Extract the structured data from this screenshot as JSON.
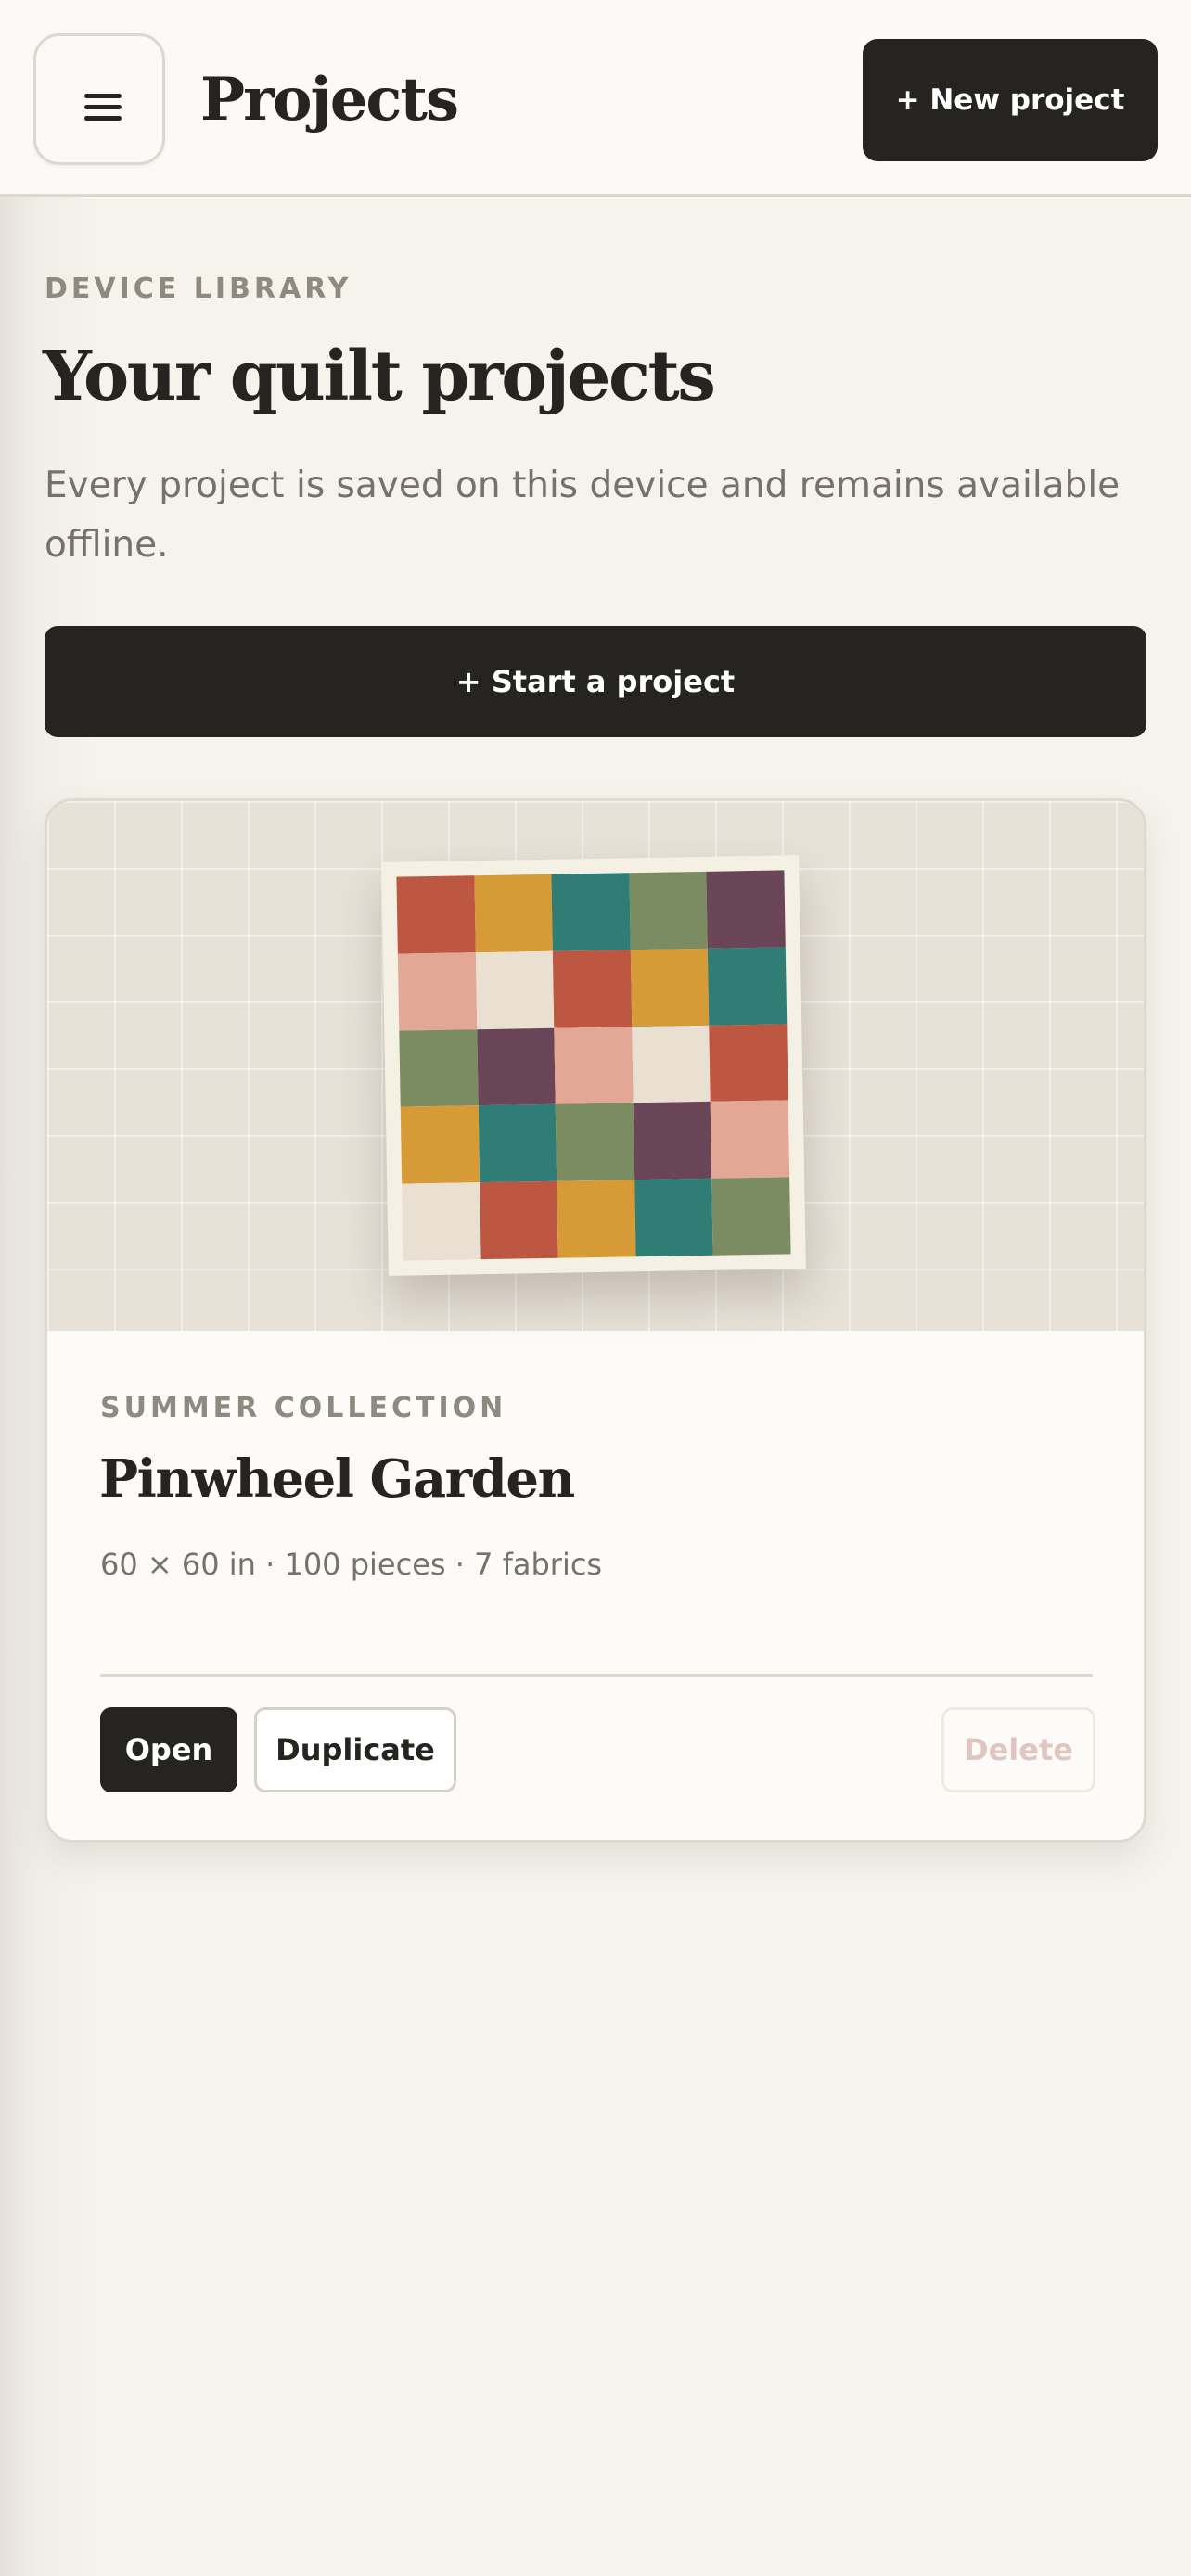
{
  "header": {
    "menu_icon": "menu-icon",
    "title": "Projects",
    "new_project_label": "+ New project"
  },
  "intro": {
    "eyebrow": "DEVICE LIBRARY",
    "heading": "Your quilt projects",
    "description": "Every project is saved on this device and remains available offline.",
    "start_label": "+ Start a project"
  },
  "projects": [
    {
      "collection": "SUMMER COLLECTION",
      "name": "Pinwheel Garden",
      "meta": "60 × 60 in · 100 pieces · 7 fabrics",
      "actions": {
        "open": "Open",
        "duplicate": "Duplicate",
        "delete": "Delete"
      },
      "quilt_patches": [
        "#bd5741",
        "#d69b36",
        "#2f7d74",
        "#7b8c63",
        "#6a4558",
        "#e2a795",
        "#e9e0d1",
        "#bd5741",
        "#d69b36",
        "#2f7d74",
        "#7b8c63",
        "#6a4558",
        "#e2a795",
        "#e9e0d1",
        "#bd5741",
        "#d69b36",
        "#2f7d74",
        "#7b8c63",
        "#6a4558",
        "#e2a795",
        "#e9e0d1",
        "#bd5741",
        "#d69b36",
        "#2f7d74",
        "#7b8c63"
      ]
    }
  ],
  "colors": {
    "primary": "#252420",
    "muted_text": "#76716a",
    "eyebrow_text": "#8f8a81",
    "background": "#f6f3ed",
    "delete_disabled": "#e0c6c0"
  }
}
